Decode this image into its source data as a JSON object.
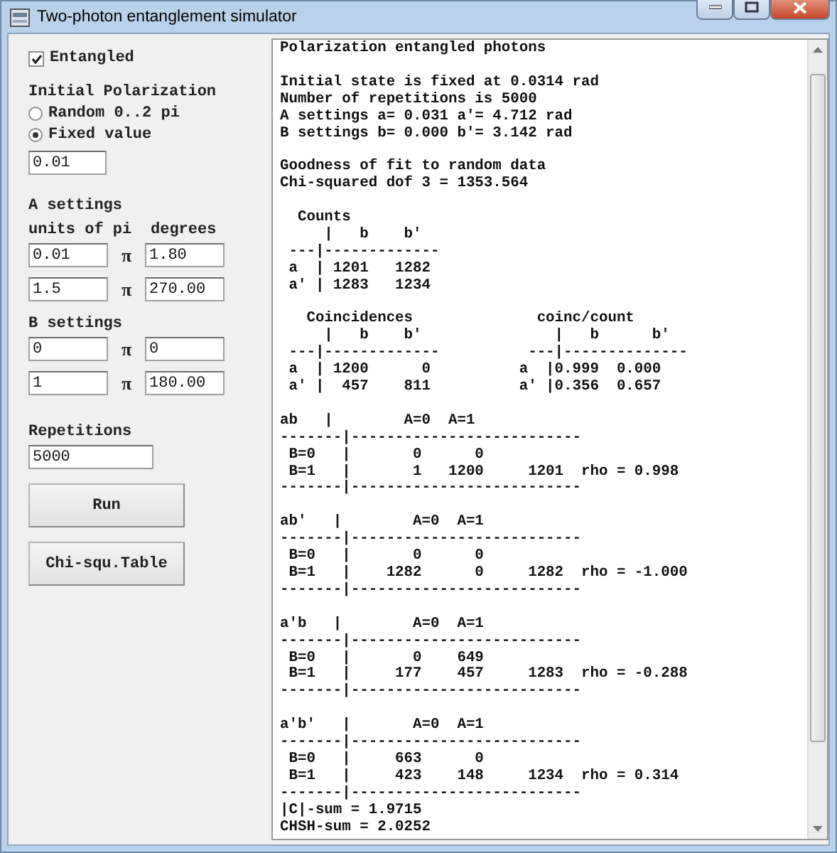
{
  "window": {
    "title": "Two-photon entanglement simulator"
  },
  "controls": {
    "entangled": {
      "label": "Entangled",
      "checked": true
    },
    "initial_polarization": {
      "heading": "Initial Polarization",
      "options": [
        {
          "label": "Random 0..2 pi",
          "selected": false
        },
        {
          "label": "Fixed value",
          "selected": true
        }
      ],
      "value": "0.01"
    },
    "a_settings": {
      "heading": "A settings",
      "column_headings": [
        "units of pi",
        "degrees"
      ],
      "rows": [
        {
          "units_of_pi": "0.01",
          "symbol": "π",
          "degrees": "1.80"
        },
        {
          "units_of_pi": "1.5",
          "symbol": "π",
          "degrees": "270.00"
        }
      ]
    },
    "b_settings": {
      "heading": "B settings",
      "rows": [
        {
          "units_of_pi": "0",
          "symbol": "π",
          "degrees": "0"
        },
        {
          "units_of_pi": "1",
          "symbol": "π",
          "degrees": "180.00"
        }
      ]
    },
    "repetitions": {
      "label": "Repetitions",
      "value": "5000"
    },
    "buttons": [
      "Run",
      "Chi-squ.Table"
    ]
  },
  "output": {
    "blocks": [
      [
        "Polarization entangled photons"
      ],
      [
        "Initial state is fixed at 0.0314 rad",
        "Number of repetitions is 5000",
        "A settings a= 0.031 a'= 4.712 rad",
        "B settings b= 0.000 b'= 3.142 rad"
      ],
      [
        "Goodness of fit to random data",
        "Chi-squared dof 3 = 1353.564"
      ],
      [
        "  Counts",
        "     |   b    b'",
        " ---|-------------",
        " a  | 1201   1282",
        " a' | 1283   1234"
      ],
      [
        "   Coincidences              coinc/count",
        "     |   b    b'               |   b      b'",
        " ---|-------------          ---|--------------",
        " a  | 1200      0          a  |0.999  0.000",
        " a' |  457    811          a' |0.356  0.657"
      ],
      [
        "ab   |        A=0  A=1",
        "-------|--------------------------",
        " B=0   |       0      0",
        " B=1   |       1   1200     1201  rho = 0.998",
        "-------|--------------------------"
      ],
      [
        "ab'   |        A=0  A=1",
        "-------|--------------------------",
        " B=0   |       0      0",
        " B=1   |    1282      0     1282  rho = -1.000",
        "-------|--------------------------"
      ],
      [
        "a'b   |        A=0  A=1",
        "-------|--------------------------",
        " B=0   |       0    649",
        " B=1   |     177    457     1283  rho = -0.288",
        "-------|--------------------------"
      ],
      [
        "a'b'   |       A=0  A=1",
        "-------|--------------------------",
        " B=0   |     663      0",
        " B=1   |     423    148     1234  rho = 0.314",
        "-------|--------------------------",
        "|C|-sum = 1.9715",
        "CHSH-sum = 2.0252"
      ]
    ]
  }
}
